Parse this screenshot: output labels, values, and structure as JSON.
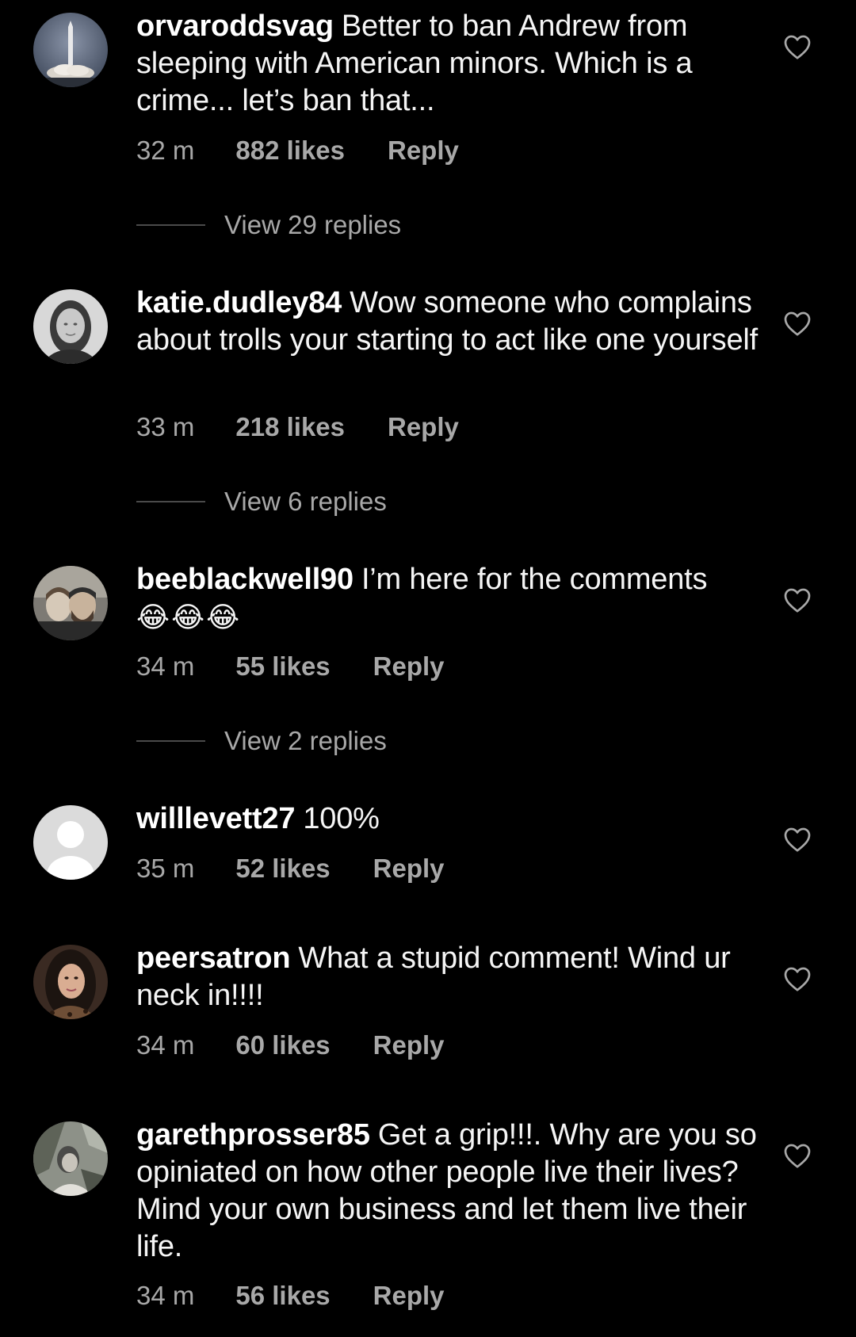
{
  "comments": [
    {
      "username": "orvaroddsvag",
      "text": "Better to ban Andrew from sleeping with American minors. Which is a crime... let’s ban that...",
      "time": "32 m",
      "likes": "882 likes",
      "reply": "Reply",
      "view_replies": "View 29 replies"
    },
    {
      "username": "katie.dudley84",
      "text": "Wow someone who complains about trolls your starting to act like one yourself",
      "time": "33 m",
      "likes": "218 likes",
      "reply": "Reply",
      "view_replies": "View 6 replies"
    },
    {
      "username": "beeblackwell90",
      "text": "I’m here for the comments",
      "emoji": "😂😂😂",
      "time": "34 m",
      "likes": "55 likes",
      "reply": "Reply",
      "view_replies": "View 2 replies"
    },
    {
      "username": "willlevett27",
      "text": "100%",
      "time": "35 m",
      "likes": "52 likes",
      "reply": "Reply"
    },
    {
      "username": "peersatron",
      "text": "What a stupid comment! Wind ur neck in!!!!",
      "time": "34 m",
      "likes": "60 likes",
      "reply": "Reply"
    },
    {
      "username": "garethprosser85",
      "text": "Get a grip!!!. Why are you so opiniated on how other people live their lives? Mind your own business and let them live their life.",
      "time": "34 m",
      "likes": "56 likes",
      "reply": "Reply"
    }
  ],
  "icons": {
    "like": "heart-outline-icon",
    "avatar_default": "default-user-silhouette"
  },
  "colors": {
    "background": "#000000",
    "text": "#f5f5f5",
    "secondary": "#a8a8a8"
  }
}
